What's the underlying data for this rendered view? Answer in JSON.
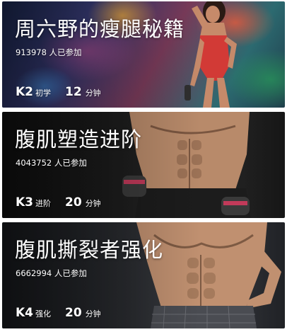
{
  "courses": [
    {
      "title": "周六野的瘦腿秘籍",
      "participants": "913978 人已参加",
      "level": "K2",
      "level_name": "初学",
      "duration": "12",
      "duration_unit": "分钟"
    },
    {
      "title": "腹肌塑造进阶",
      "participants": "4043752 人已参加",
      "level": "K3",
      "level_name": "进阶",
      "duration": "20",
      "duration_unit": "分钟"
    },
    {
      "title": "腹肌撕裂者强化",
      "participants": "6662994 人已参加",
      "level": "K4",
      "level_name": "强化",
      "duration": "20",
      "duration_unit": "分钟"
    }
  ]
}
